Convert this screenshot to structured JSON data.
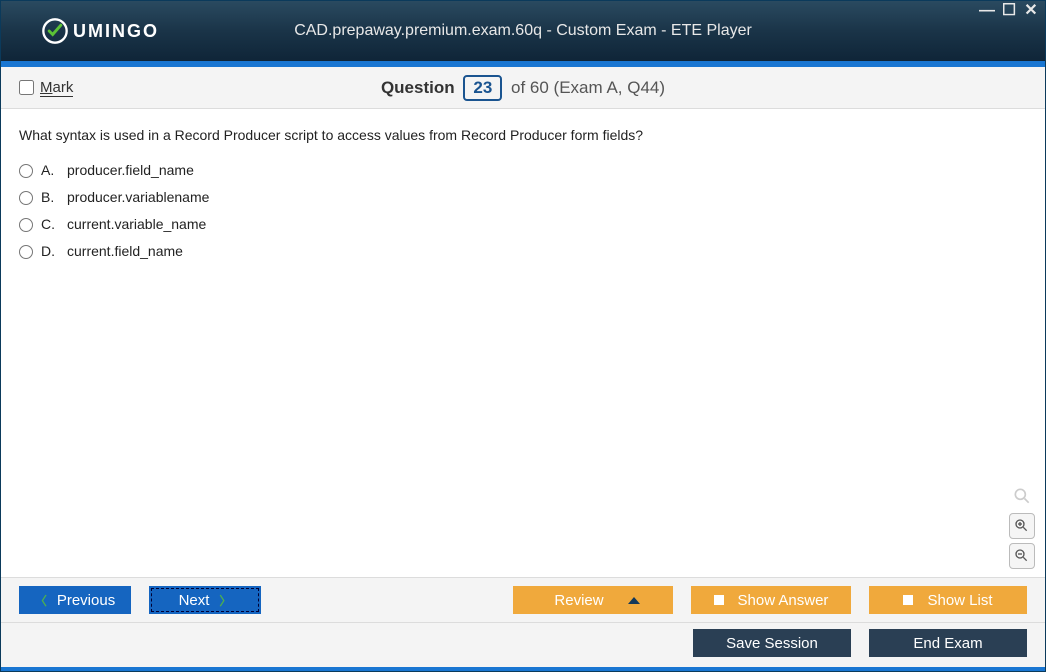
{
  "window": {
    "title": "CAD.prepaway.premium.exam.60q - Custom Exam - ETE Player",
    "brand": "UMINGO"
  },
  "header": {
    "mark_label": "Mark",
    "question_word": "Question",
    "question_number": "23",
    "of_text": "of 60 (Exam A, Q44)"
  },
  "question": {
    "text": "What syntax is used in a Record Producer script to access values from Record Producer form fields?",
    "options": [
      {
        "letter": "A.",
        "text": "producer.field_name"
      },
      {
        "letter": "B.",
        "text": "producer.variablename"
      },
      {
        "letter": "C.",
        "text": "current.variable_name"
      },
      {
        "letter": "D.",
        "text": "current.field_name"
      }
    ]
  },
  "buttons": {
    "previous": "Previous",
    "next": "Next",
    "review": "Review",
    "show_answer": "Show Answer",
    "show_list": "Show List",
    "save_session": "Save Session",
    "end_exam": "End Exam"
  }
}
